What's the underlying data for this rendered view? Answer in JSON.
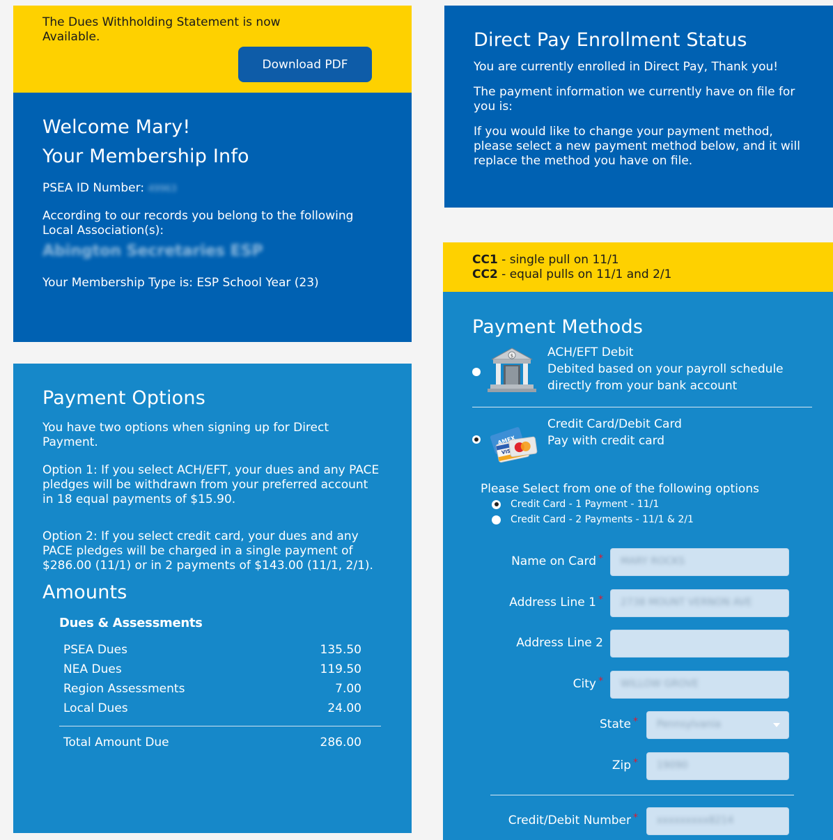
{
  "notice": {
    "text": "The Dues Withholding Statement is now Available.",
    "button": "Download PDF"
  },
  "welcome": {
    "greeting": "Welcome Mary!",
    "membership_title": "Your Membership Info",
    "id_label": "PSEA ID Number:",
    "id_value": "49963",
    "records_text": "According to our records you belong to the following Local Association(s):",
    "local_association": "Abington Secretaries ESP",
    "membership_type": "Your Membership Type is: ESP School Year (23)"
  },
  "payment_options": {
    "title": "Payment Options",
    "intro": "You have two options when signing up for Direct Payment.",
    "option1": "Option 1: If you select ACH/EFT, your dues and any PACE pledges will be withdrawn from your preferred account in 18 equal payments of $15.90.",
    "option2": "Option 2:  If you select credit card, your dues and any PACE pledges will be charged in a single payment of $286.00 (11/1) or in 2 payments of $143.00 (11/1, 2/1).",
    "amounts_title": "Amounts",
    "dues_heading": "Dues & Assessments",
    "rows": [
      {
        "label": "PSEA Dues",
        "value": "135.50"
      },
      {
        "label": "NEA Dues",
        "value": "119.50"
      },
      {
        "label": "Region Assessments",
        "value": "7.00"
      },
      {
        "label": "Local Dues",
        "value": "24.00"
      }
    ],
    "total_label": "Total Amount Due",
    "total_value": "286.00"
  },
  "enrollment": {
    "title": "Direct Pay Enrollment Status",
    "line1": "You are currently enrolled in Direct Pay, Thank you!",
    "line2": "The payment information we currently have on file for you is:",
    "line3": "If you would like to change your payment method, please select a new payment method below, and it will replace the method you have on file."
  },
  "cc_note": {
    "cc1_code": "CC1",
    "cc1_text": " - single pull on 11/1",
    "cc2_code": "CC2",
    "cc2_text": " - equal pulls on 11/1 and 2/1"
  },
  "methods": {
    "title": "Payment Methods",
    "ach_title": "ACH/EFT Debit",
    "ach_line1": "Debited based on your payroll schedule",
    "ach_line2": "directly from your bank account",
    "cc_title": "Credit Card/Debit Card",
    "cc_line1": "Pay with credit card",
    "ach_icon": "bank-icon",
    "cc_icon": "credit-cards-icon",
    "selected": "cc",
    "options_title": "Please Select from one of the following options",
    "option_a": "Credit Card - 1 Payment - 11/1",
    "option_b": "Credit Card - 2 Payments - 11/1 & 2/1",
    "selected_option": "a"
  },
  "form": {
    "name_label": "Name on Card",
    "name_value": "MARY ROCKS",
    "addr1_label": "Address Line 1",
    "addr1_value": "2738 MOUNT VERNON AVE",
    "addr2_label": "Address Line 2",
    "addr2_value": "",
    "city_label": "City",
    "city_value": "WILLOW GROVE",
    "state_label": "State",
    "state_value": "Pennsylvania",
    "zip_label": "Zip",
    "zip_value": "19090",
    "card_label": "Credit/Debit Number",
    "card_value": "xxxxxxxxx8214",
    "required_mark": "*"
  },
  "colors": {
    "yellow": "#fed100",
    "dark_blue": "#0061b2",
    "mid_blue": "#1688c9",
    "button": "#0e5ca8",
    "required": "#e0182d"
  }
}
